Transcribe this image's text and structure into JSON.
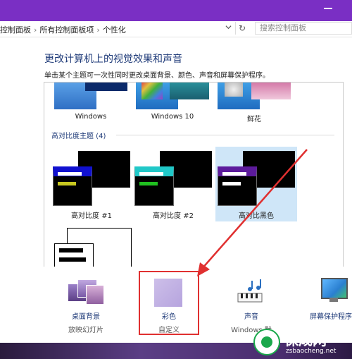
{
  "window": {
    "accent": "#7a2fc4"
  },
  "address": {
    "breadcrumbs": [
      "控制面板",
      "所有控制面板项",
      "个性化"
    ],
    "separator": "›",
    "dropdown_icon": "chevron-down-icon",
    "refresh_symbol": "↻",
    "search_placeholder": "搜索控制面板"
  },
  "main": {
    "title": "更改计算机上的视觉效果和声音",
    "subtitle": "单击某个主题可一次性同时更改桌面背景、颜色、声音和屏幕保护程序。"
  },
  "themes": {
    "top_row": [
      {
        "label": "Windows",
        "color": "#3a78d1"
      },
      {
        "label": "Windows 10",
        "color": "#2a8fd6"
      },
      {
        "label": "鲜花",
        "color": "#c04f91"
      }
    ],
    "high_contrast_header": "高对比度主题 (4)",
    "high_contrast": [
      {
        "label": "高对比度 #1",
        "bar_top": "#ffffff",
        "bar_bottom": "#c8c820",
        "title_bg": "#1010d0"
      },
      {
        "label": "高对比度 #2",
        "bar_top": "#ffffff",
        "bar_bottom": "#20c020",
        "title_bg": "#20c8c8"
      },
      {
        "label": "高对比黑色",
        "bar_top": "#ffffff",
        "bar_bottom": "#ffffff",
        "title_bg": "#5c1a9c",
        "selected": true
      }
    ]
  },
  "bottom": {
    "items": [
      {
        "title": "桌面背景",
        "subtitle": "放映幻灯片"
      },
      {
        "title": "彩色",
        "subtitle": "自定义"
      },
      {
        "title": "声音",
        "subtitle": "Windows 默"
      },
      {
        "title": "屏幕保护程序",
        "subtitle": ""
      }
    ],
    "highlight_color": "#e03030"
  },
  "watermark": {
    "brand": "保成网",
    "domain": "zsbaocheng.net"
  }
}
